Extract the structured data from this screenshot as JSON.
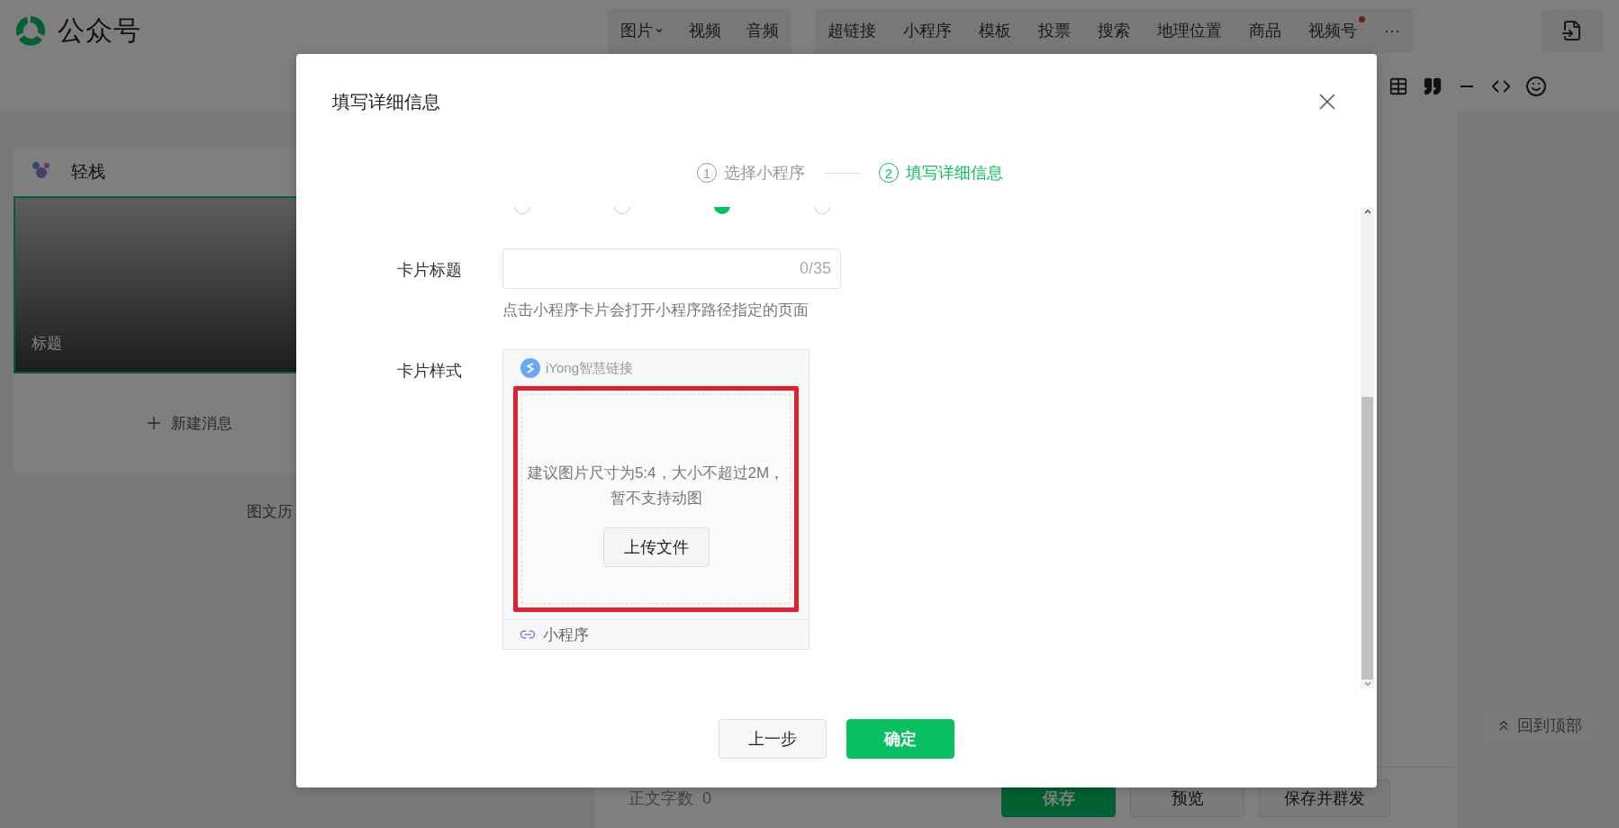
{
  "app": {
    "name": "公众号"
  },
  "insert_menu": {
    "media": [
      {
        "label": "图片",
        "has_menu": true
      },
      {
        "label": "视频",
        "has_menu": false
      },
      {
        "label": "音频",
        "has_menu": false
      }
    ],
    "items": [
      {
        "label": "超链接",
        "dot": false
      },
      {
        "label": "小程序",
        "dot": false
      },
      {
        "label": "模板",
        "dot": false
      },
      {
        "label": "投票",
        "dot": false
      },
      {
        "label": "搜索",
        "dot": false
      },
      {
        "label": "地理位置",
        "dot": false
      },
      {
        "label": "商品",
        "dot": false
      },
      {
        "label": "视频号",
        "dot": true
      },
      {
        "label": "···",
        "dot": false
      }
    ]
  },
  "account": {
    "name": "轻栈"
  },
  "articles": [
    {
      "title_placeholder": "标题",
      "selected": true
    }
  ],
  "new_message": "新建消息",
  "history_link": "图文历",
  "editor": {
    "word_count_label": "正文字数",
    "word_count": "0",
    "buttons": [
      {
        "label": "保存",
        "kind": "primary"
      },
      {
        "label": "预览",
        "kind": "default"
      },
      {
        "label": "保存并群发",
        "kind": "default"
      }
    ]
  },
  "back_to_top": "回到顶部",
  "dialog": {
    "title": "填写详细信息",
    "steps": [
      {
        "number": "1",
        "label": "选择小程序",
        "selected": false
      },
      {
        "number": "2",
        "label": "填写详细信息",
        "selected": true
      }
    ],
    "type_options": [
      {
        "selected": false
      },
      {
        "selected": false
      },
      {
        "selected": true
      },
      {
        "selected": false
      }
    ],
    "card_title": {
      "label": "卡片标题",
      "counter": "0/35",
      "hint": "点击小程序卡片会打开小程序路径指定的页面"
    },
    "card_style": {
      "label": "卡片样式",
      "app_name": "iYong智慧链接",
      "upload_hint": "建议图片尺寸为5:4，大小不超过2M，暂不支持动图",
      "upload_button": "上传文件",
      "footer": "小程序",
      "highlighted": true
    },
    "buttons": [
      {
        "label": "上一步",
        "kind": "default"
      },
      {
        "label": "确定",
        "kind": "primary"
      }
    ]
  }
}
